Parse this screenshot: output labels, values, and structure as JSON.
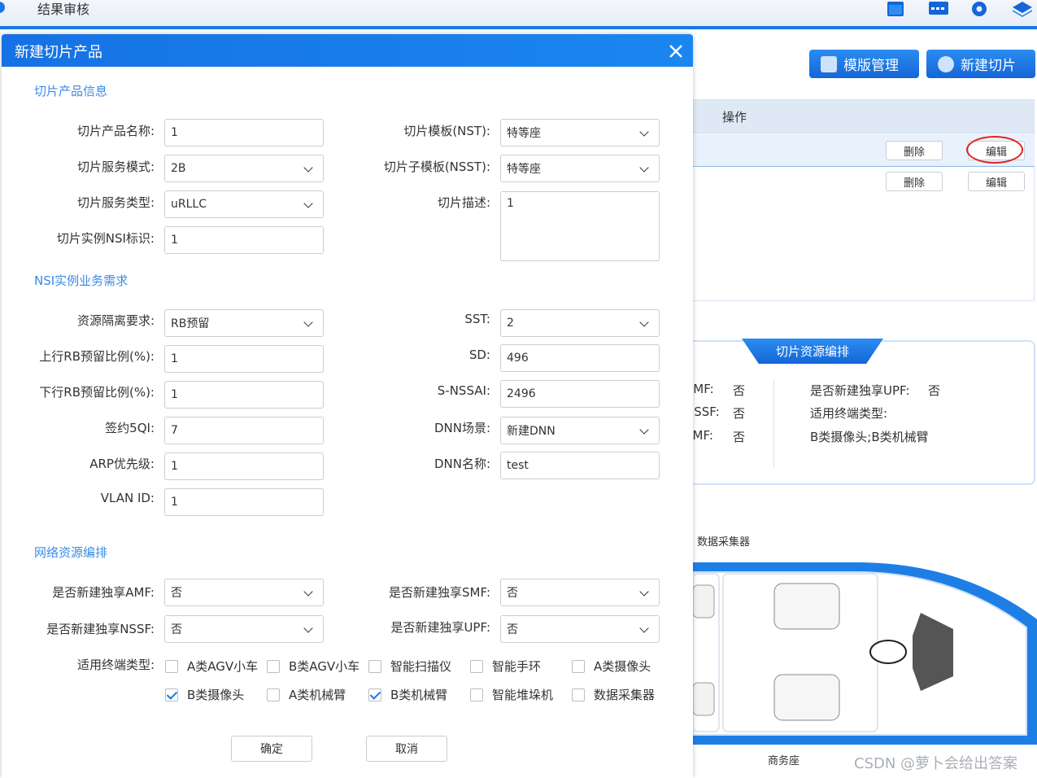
{
  "app": {
    "title": "结果审核"
  },
  "top_icons": [
    "calendar-icon",
    "monitor-icon",
    "gear-icon",
    "layers-icon"
  ],
  "header_actions": {
    "template_mgmt": "模版管理",
    "new_slice": "新建切片"
  },
  "table": {
    "operation_header": "操作",
    "rows": [
      {
        "delete": "删除",
        "edit": "编辑"
      },
      {
        "delete": "删除",
        "edit": "编辑"
      }
    ]
  },
  "resource_panel": {
    "tab": "切片资源编排",
    "left_items": [
      {
        "label": "AMF:",
        "value": "否"
      },
      {
        "label": "NSSF:",
        "value": "否"
      },
      {
        "label": "SMF:",
        "value": "否"
      }
    ],
    "upf_label": "是否新建独享UPF:",
    "upf_value": "否",
    "terminal_label": "适用终端类型:",
    "terminal_value": "B类摄像头;B类机械臂"
  },
  "diagram": {
    "collector_label": "数据采集器",
    "train_label": "商务座"
  },
  "watermark": "CSDN @萝卜会给出答案",
  "modal": {
    "title": "新建切片产品",
    "sections": {
      "product": "切片产品信息",
      "nsi": "NSI实例业务需求",
      "network": "网络资源编排"
    },
    "product": {
      "name_label": "切片产品名称:",
      "name_value": "1",
      "mode_label": "切片服务模式:",
      "mode_value": "2B",
      "type_label": "切片服务类型:",
      "type_value": "uRLLC",
      "nsi_label": "切片实例NSI标识:",
      "nsi_value": "1",
      "nst_label": "切片模板(NST):",
      "nst_value": "特等座",
      "nsst_label": "切片子模板(NSST):",
      "nsst_value": "特等座",
      "desc_label": "切片描述:",
      "desc_value": "1"
    },
    "nsi": {
      "isolation_label": "资源隔离要求:",
      "isolation_value": "RB预留",
      "ul_label": "上行RB预留比例(%):",
      "ul_value": "1",
      "dl_label": "下行RB预留比例(%):",
      "dl_value": "1",
      "qi_label": "签约5QI:",
      "qi_value": "7",
      "arp_label": "ARP优先级:",
      "arp_value": "1",
      "vlan_label": "VLAN ID:",
      "vlan_value": "1",
      "sst_label": "SST:",
      "sst_value": "2",
      "sd_label": "SD:",
      "sd_value": "496",
      "snssai_label": "S-NSSAI:",
      "snssai_value": "2496",
      "dnn_scene_label": "DNN场景:",
      "dnn_scene_value": "新建DNN",
      "dnn_name_label": "DNN名称:",
      "dnn_name_value": "test"
    },
    "network": {
      "amf_label": "是否新建独享AMF:",
      "amf_value": "否",
      "nssf_label": "是否新建独享NSSF:",
      "nssf_value": "否",
      "smf_label": "是否新建独享SMF:",
      "smf_value": "否",
      "upf_label": "是否新建独享UPF:",
      "upf_value": "否",
      "terminal_label": "适用终端类型:",
      "terminals": [
        {
          "label": "A类AGV小车",
          "checked": false
        },
        {
          "label": "B类AGV小车",
          "checked": false
        },
        {
          "label": "智能扫描仪",
          "checked": false
        },
        {
          "label": "智能手环",
          "checked": false
        },
        {
          "label": "A类摄像头",
          "checked": false
        },
        {
          "label": "B类摄像头",
          "checked": true
        },
        {
          "label": "A类机械臂",
          "checked": false
        },
        {
          "label": "B类机械臂",
          "checked": true
        },
        {
          "label": "智能堆垛机",
          "checked": false
        },
        {
          "label": "数据采集器",
          "checked": false
        }
      ]
    },
    "confirm": "确定",
    "cancel": "取消"
  }
}
